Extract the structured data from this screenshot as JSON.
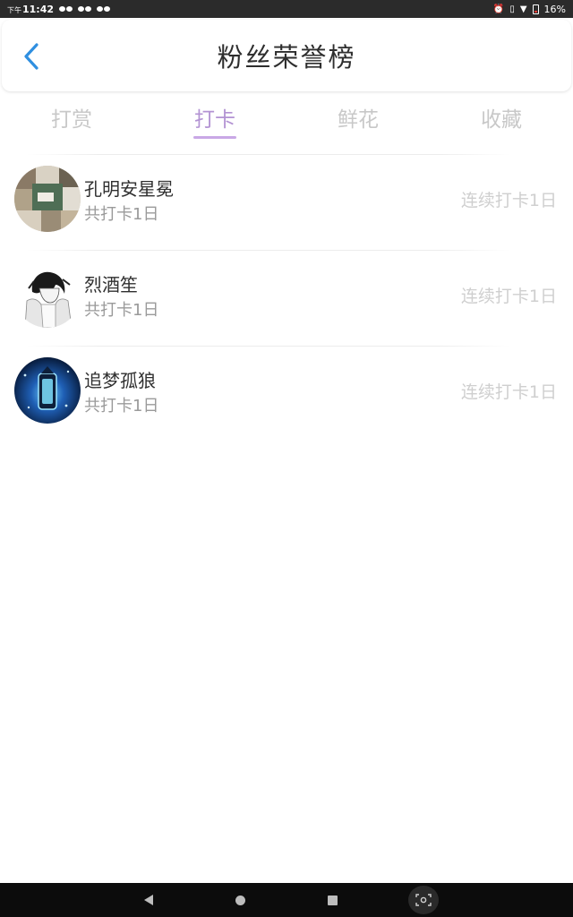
{
  "status_bar": {
    "time_prefix": "下午",
    "time": "11:42",
    "battery": "16%"
  },
  "header": {
    "title": "粉丝荣誉榜"
  },
  "tabs": [
    {
      "label": "打赏"
    },
    {
      "label": "打卡"
    },
    {
      "label": "鲜花"
    },
    {
      "label": "收藏"
    }
  ],
  "active_tab": "打卡",
  "list": [
    {
      "name": "孔明安星冕",
      "total": "共打卡1日",
      "streak": "连续打卡1日"
    },
    {
      "name": "烈酒笙",
      "total": "共打卡1日",
      "streak": "连续打卡1日"
    },
    {
      "name": "追梦孤狼",
      "total": "共打卡1日",
      "streak": "连续打卡1日"
    }
  ],
  "colors": {
    "accent_purple": "#b393d3",
    "back_blue": "#2f8fe0",
    "inactive_tab": "#c8c8c8"
  }
}
